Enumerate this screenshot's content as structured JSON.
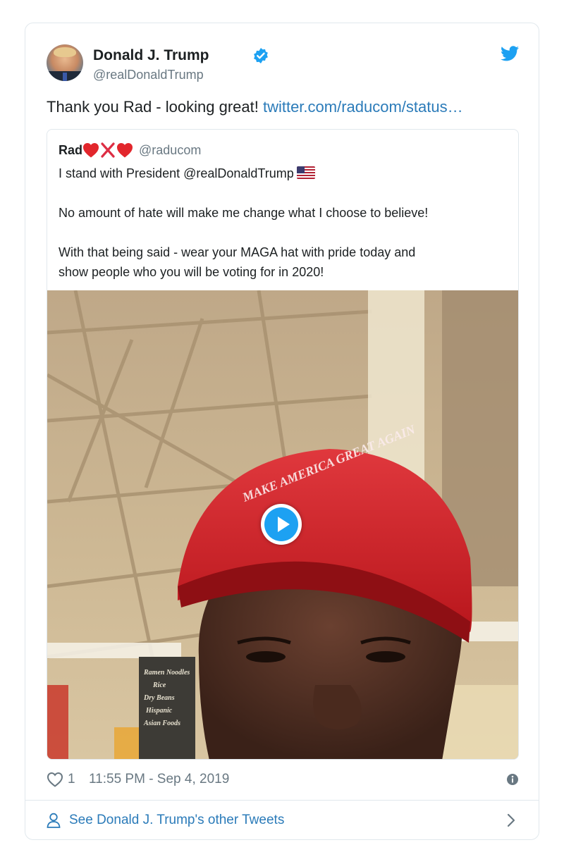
{
  "author": {
    "name": "Donald J. Trump",
    "handle": "@realDonaldTrump",
    "verified": true
  },
  "tweet": {
    "text": "Thank you Rad - looking great! ",
    "link_text": "twitter.com/raducom/status…"
  },
  "quoted_tweet": {
    "name": "Rad",
    "emojis": [
      "red-heart-emoji",
      "cross-mark-emoji",
      "red-heart-emoji"
    ],
    "handle": "@raducom",
    "line1": "I stand with President @realDonaldTrump",
    "line2": "No amount of hate will make me change what I choose to believe!",
    "line3a": "With that being said - wear your MAGA hat with pride today and",
    "line3b": "show people who you will be voting for in 2020!",
    "hat_text": "MAKE AMERICA GREAT AGAIN",
    "sign_text": [
      "Ramen Noodles",
      "Rice",
      "Dry Beans",
      "Hispanic",
      "Asian Foods"
    ],
    "media_type": "video"
  },
  "meta": {
    "like_count": "1",
    "timestamp": "11:55 PM - Sep 4, 2019"
  },
  "footer": {
    "label": "See Donald J. Trump's other Tweets"
  },
  "colors": {
    "link": "#2b7bb9",
    "twitter_blue": "#1da1f2",
    "muted": "#697882",
    "border": "#e1e8ed"
  }
}
